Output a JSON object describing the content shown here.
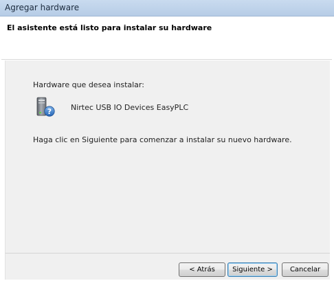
{
  "window": {
    "title": "Agregar hardware"
  },
  "header": {
    "title": "El asistente está listo para instalar su hardware"
  },
  "content": {
    "hardware_label": "Hardware que desea instalar:",
    "device_name": "Nirtec USB IO Devices EasyPLC",
    "device_icon": "device-question-icon",
    "instruction": "Haga clic en Siguiente para comenzar a instalar su nuevo hardware."
  },
  "buttons": {
    "back_label": "< Atrás",
    "next_label": "Siguiente >",
    "cancel_label": "Cancelar"
  },
  "colors": {
    "titlebar": "#c9dbef",
    "panel": "#f0f0f0",
    "default_button_border": "#3c7fb1"
  }
}
